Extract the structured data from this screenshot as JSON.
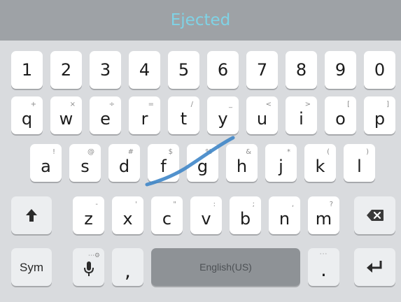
{
  "suggestion": {
    "text": "Ejected"
  },
  "accent_color": "#7fd3e6",
  "swipe_color": "#3f86c8",
  "rows": {
    "numbers": [
      {
        "label": "1"
      },
      {
        "label": "2"
      },
      {
        "label": "3"
      },
      {
        "label": "4"
      },
      {
        "label": "5"
      },
      {
        "label": "6"
      },
      {
        "label": "7"
      },
      {
        "label": "8"
      },
      {
        "label": "9"
      },
      {
        "label": "0"
      }
    ],
    "row1": [
      {
        "label": "q",
        "sub": "+"
      },
      {
        "label": "w",
        "sub": "×"
      },
      {
        "label": "e",
        "sub": "÷"
      },
      {
        "label": "r",
        "sub": "="
      },
      {
        "label": "t",
        "sub": "/"
      },
      {
        "label": "y",
        "sub": "_"
      },
      {
        "label": "u",
        "sub": "<"
      },
      {
        "label": "i",
        "sub": ">"
      },
      {
        "label": "o",
        "sub": "["
      },
      {
        "label": "p",
        "sub": "]"
      }
    ],
    "row2": [
      {
        "label": "a",
        "sub": "!"
      },
      {
        "label": "s",
        "sub": "@"
      },
      {
        "label": "d",
        "sub": "#"
      },
      {
        "label": "f",
        "sub": "$"
      },
      {
        "label": "g",
        "sub": "%"
      },
      {
        "label": "h",
        "sub": "&"
      },
      {
        "label": "j",
        "sub": "*"
      },
      {
        "label": "k",
        "sub": "("
      },
      {
        "label": "l",
        "sub": ")"
      }
    ],
    "row3": [
      {
        "label": "z",
        "sub": "-"
      },
      {
        "label": "x",
        "sub": "'"
      },
      {
        "label": "c",
        "sub": "\""
      },
      {
        "label": "v",
        "sub": ":"
      },
      {
        "label": "b",
        "sub": ";"
      },
      {
        "label": "n",
        "sub": ","
      },
      {
        "label": "m",
        "sub": "?"
      }
    ]
  },
  "bottom": {
    "sym_label": "Sym",
    "mic_sub": "⋯⚙",
    "comma_label": ",",
    "space_label": "English(US)",
    "period_label": ".",
    "period_sub": "···"
  },
  "icons": {
    "shift": "shift-arrow-icon",
    "backspace": "backspace-icon",
    "mic": "microphone-icon",
    "enter": "enter-icon"
  }
}
